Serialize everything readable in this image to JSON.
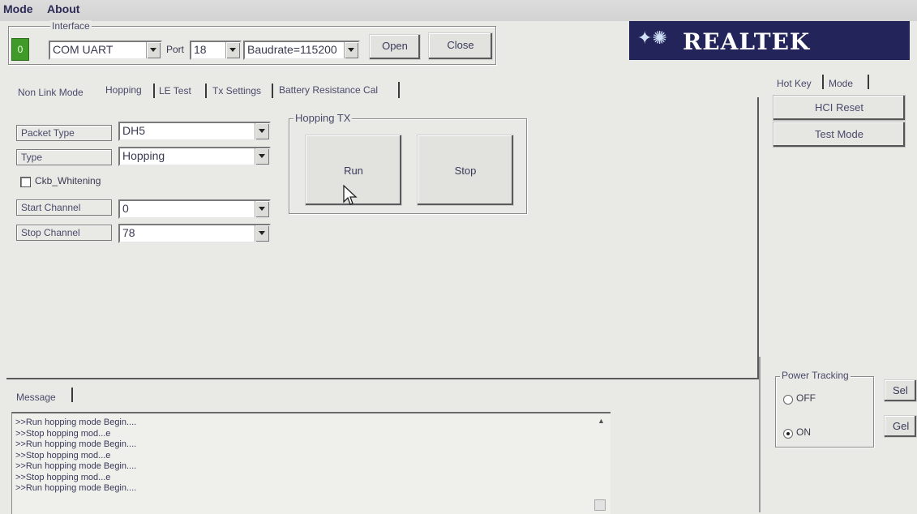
{
  "menu": [
    "Mode",
    "About"
  ],
  "interface": {
    "group_label": "Interface",
    "status_indicator": "0",
    "connection": "COM UART",
    "port_label": "Port",
    "port_value": "18",
    "baudrate": "Baudrate=115200",
    "open_label": "Open",
    "close_label": "Close"
  },
  "brand": {
    "name": "REALTEK"
  },
  "tabs": [
    {
      "label": "Non Link Mode",
      "active": false
    },
    {
      "label": "Hopping",
      "active": true
    },
    {
      "label": "LE Test",
      "active": false
    },
    {
      "label": "Tx Settings",
      "active": false
    },
    {
      "label": "Battery Resistance Cal",
      "active": false
    }
  ],
  "hopping": {
    "packet_type_label": "Packet Type",
    "packet_type_value": "DH5",
    "type_label": "Type",
    "type_value": "Hopping",
    "whitening_label": "Ckb_Whitening",
    "whitening_checked": false,
    "start_channel_label": "Start Channel",
    "start_channel_value": "0",
    "stop_channel_label": "Stop Channel",
    "stop_channel_value": "78",
    "tx_group_label": "Hopping TX",
    "run_label": "Run",
    "stop_label": "Stop"
  },
  "side": {
    "tabs": [
      {
        "label": "Hot Key",
        "active": true
      },
      {
        "label": "Mode",
        "active": false
      }
    ],
    "hci_reset_label": "HCI Reset",
    "test_mode_label": "Test Mode",
    "power_tracking": {
      "group_label": "Power Tracking",
      "off_label": "OFF",
      "on_label": "ON",
      "selected": "ON",
      "set_label": "Sel",
      "get_label": "Gel"
    }
  },
  "message": {
    "tab_label": "Message",
    "lines": [
      ">>Run hopping mode Begin....",
      ">>Stop hopping mod...e",
      ">>Run hopping mode Begin....",
      ">>Stop hopping mod...e",
      ">>Run hopping mode Begin....",
      ">>Stop hopping mod...e",
      ">>Run hopping mode Begin...."
    ]
  },
  "colors": {
    "indicator": "#3f9a2a",
    "brand_bg": "#23255a",
    "window_bg": "#e9e9e6"
  }
}
